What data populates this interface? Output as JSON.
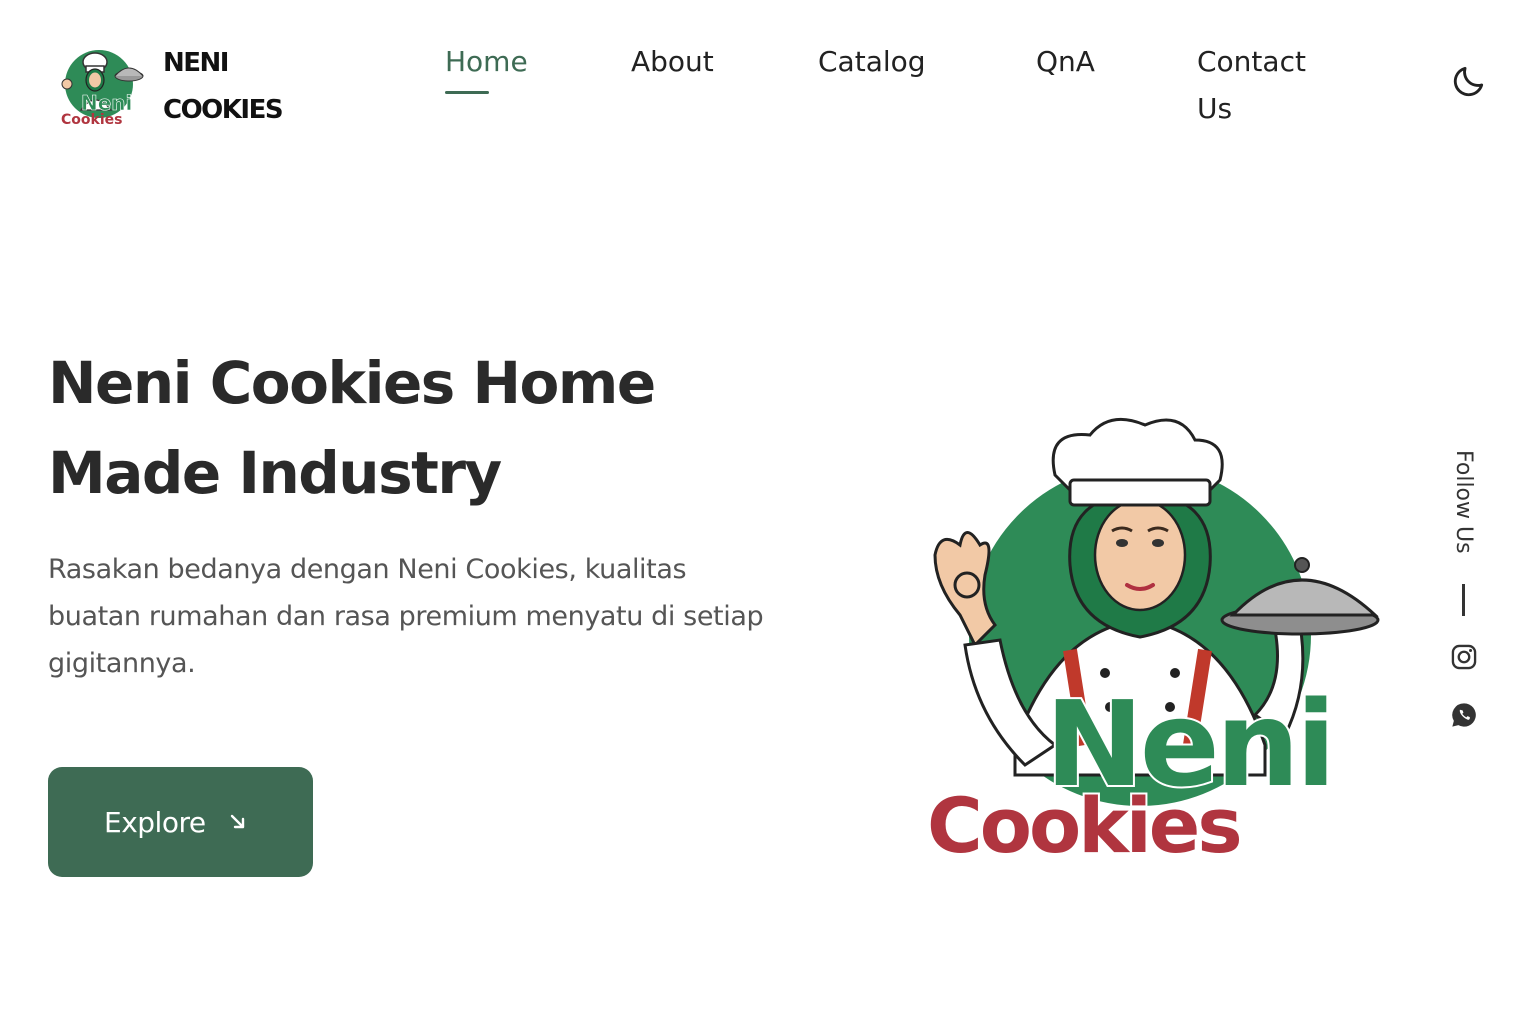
{
  "header": {
    "brand": {
      "name_line1": "NENI",
      "name_line2": "COOKIES",
      "logo_icon": "neni-cookies-chef-logo"
    },
    "nav": [
      {
        "label": "Home",
        "active": true
      },
      {
        "label": "About",
        "active": false
      },
      {
        "label": "Catalog",
        "active": false
      },
      {
        "label": "QnA",
        "active": false
      },
      {
        "label": "Contact Us",
        "active": false
      }
    ],
    "theme_toggle_icon": "moon-icon"
  },
  "hero": {
    "title": "Neni Cookies Home Made Industry",
    "description": "Rasakan bedanya dengan Neni Cookies, kualitas buatan rumahan dan rasa premium menyatu di setiap gigitannya.",
    "cta_label": "Explore",
    "cta_icon": "arrow-down-right-icon",
    "logo_text_top": "Neni",
    "logo_text_bottom": "Cookies"
  },
  "social": {
    "label": "Follow Us",
    "icons": [
      "instagram-icon",
      "whatsapp-icon"
    ]
  },
  "colors": {
    "accent": "#3e6b54",
    "logo_green": "#2e8b57",
    "logo_red": "#b0353f",
    "text_dark": "#2a2a2a",
    "text_muted": "#555555"
  }
}
